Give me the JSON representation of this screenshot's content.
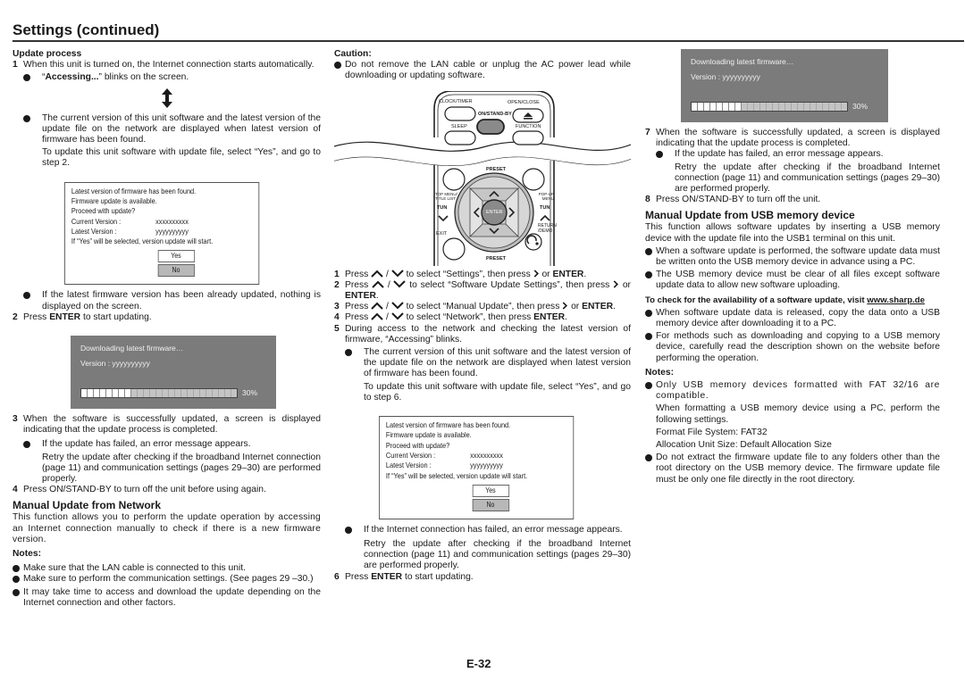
{
  "page": {
    "title": "Settings (continued)",
    "page_number": "E-32"
  },
  "left": {
    "subheading": "Update process",
    "step1": {
      "num": "1",
      "text": "When this unit is turned on, the Internet connection starts automatically.",
      "bullet1_bold": "Accessing...",
      "bullet1_pre": "“",
      "bullet1_post": "” blinks on the screen.",
      "bullet2": "The current version of this unit software and the latest version of the update file on the network are displayed when latest version of firmware has been found.",
      "bullet2_sub": "To update this unit software with update file, select “Yes”, and go to step 2."
    },
    "bullet_already": "If the latest firmware version has been already updated, nothing is displayed on the screen.",
    "step2": {
      "num": "2",
      "pre": "Press ",
      "bold": "ENTER",
      "post": " to start updating."
    },
    "step3": {
      "num": "3",
      "text": "When the software is successfully updated, a screen is displayed indicating that the update process is completed.",
      "bullet": "If the update has failed, an error message appears.",
      "bullet_sub": "Retry the update after checking if the broadband Internet connection (page 11) and communication settings (pages 29–30) are performed properly."
    },
    "step4": {
      "num": "4",
      "text": "Press ON/STAND-BY to turn off the unit before using again."
    },
    "section_network": {
      "heading": "Manual Update from Network",
      "intro": "This function allows you to perform the update operation by accessing an Internet connection manually to check if there is a new firmware version.",
      "notes_label": "Notes:",
      "notes": [
        "Make sure that the LAN cable is connected to this unit.",
        "Make sure to perform the communication settings. (See pages 29 –30.)",
        "It may take time to access and download the update depending on the Internet connection and other factors."
      ]
    }
  },
  "dialog": {
    "line1": "Latest version of firmware has been found.",
    "line2": "Firmware update is available.",
    "line3": "Proceed with update?",
    "current_label": "Current Version :",
    "current_value": "xxxxxxxxxx",
    "latest_label": "Latest Version  :",
    "latest_value": "yyyyyyyyyy",
    "note": "If “Yes” will be selected, version update will start.",
    "yes": "Yes",
    "no": "No"
  },
  "download_screen": {
    "line1": "Downloading latest firmware…",
    "line2": "Version :  yyyyyyyyyy",
    "progress_percent": 30,
    "progress_label": "30%"
  },
  "middle": {
    "caution_label": "Caution:",
    "caution": "Do not remove the LAN cable or unplug the AC power lead while downloading or updating software.",
    "remote": {
      "clock_timer": "CLOCK/TIMER",
      "open_close": "OPEN/CLOSE",
      "on_standby": "ON/STAND-BY",
      "sleep": "SLEEP",
      "function": "FUNCTION",
      "preset_top": "PRESET",
      "preset_bottom": "PRESET",
      "top_menu": "TOP MENU/ TITLE LIST",
      "popup_menu": "POP-UP MENU",
      "tun_left": "TUN",
      "tun_right": "TUN",
      "enter": "ENTER",
      "exit": "EXIT",
      "return_demo": "RETURN /DEMO"
    },
    "steps": [
      {
        "num": "1",
        "a": "Press ",
        "b": " to select “Settings”, then press ",
        "c": " or ",
        "bold": "ENTER",
        "d": "."
      },
      {
        "num": "2",
        "a": "Press ",
        "b": " to select “Software Update Settings”, then press ",
        "c": " or ",
        "bold": "ENTER",
        "d": "."
      },
      {
        "num": "3",
        "a": "Press ",
        "b": " to select “Manual Update”, then press ",
        "c": " or ",
        "bold": "ENTER",
        "d": "."
      },
      {
        "num": "4",
        "a": "Press ",
        "b": " to select “Network”, then press ",
        "bold": "ENTER",
        "d": "."
      }
    ],
    "step5": {
      "num": "5",
      "text": "During access to the network and checking the latest version of firmware, “Accessing” blinks.",
      "bullet": "The current version of this unit software and the latest version of the update file on the network are displayed when latest version of firmware has been found.",
      "bullet_sub": "To update this unit software with update file, select “Yes”, and go to step 6."
    },
    "bullet_failed": "If the Internet connection has failed, an error message appears.",
    "bullet_failed_sub": "Retry the update after checking if the broadband Internet connection (page 11) and communication settings (pages 29–30) are performed properly.",
    "step6": {
      "num": "6",
      "pre": "Press ",
      "bold": "ENTER",
      "post": " to start updating."
    }
  },
  "right": {
    "step7": {
      "num": "7",
      "text": "When the software is successfully updated, a screen is displayed indicating that the update process is completed.",
      "bullet": "If the update has failed, an error message appears.",
      "bullet_sub": "Retry the update after checking if the broadband Internet connection (page 11) and communication settings (pages 29–30) are performed properly."
    },
    "step8": {
      "num": "8",
      "text": "Press ON/STAND-BY to turn off the unit."
    },
    "section_usb": {
      "heading": "Manual Update from USB memory device",
      "intro": "This function allows software updates by inserting a USB memory device with the update file into the USB1 terminal on this unit.",
      "bullets": [
        "When a software update is performed, the software update data must be written onto the USB memory device in advance using a PC.",
        "The USB memory device must be clear of all files except software update data to allow new software uploading."
      ],
      "check_text": "To check for the availability of a software update, visit ",
      "check_link": "www.sharp.de",
      "bullets2": [
        "When software update data is released, copy the data onto a USB memory device after downloading it to a PC.",
        "For methods such as downloading and copying to a USB memory device, carefully read the description shown on the website before performing the operation."
      ],
      "notes_label": "Notes:",
      "note1": "Only USB memory devices formatted with FAT 32/16 are compatible.",
      "note1_sub1": "When formatting a USB memory device using a PC, perform the following settings.",
      "note1_sub2": "Format File System: FAT32",
      "note1_sub3": "Allocation Unit Size: Default Allocation Size",
      "note2": "Do not extract the firmware update file to any folders other than the root directory on the USB memory device. The firmware update file must be only one file directly in the root directory."
    }
  }
}
